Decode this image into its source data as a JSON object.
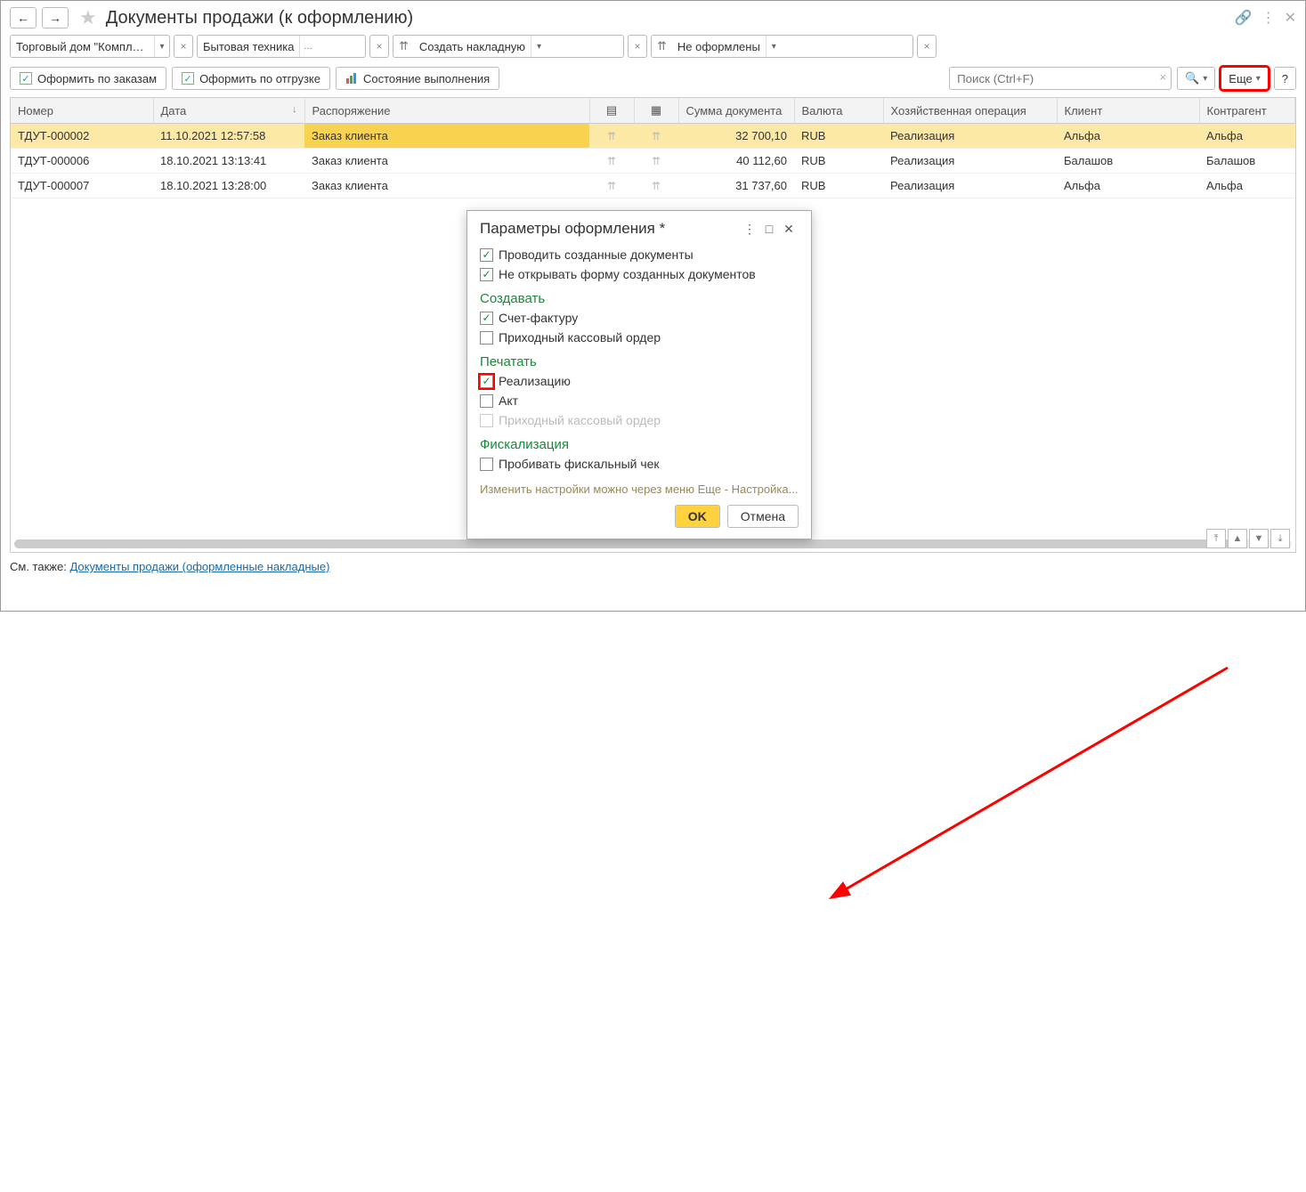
{
  "header": {
    "title": "Документы продажи (к оформлению)"
  },
  "filters": {
    "org": "Торговый дом \"Комплексн",
    "warehouse": "Бытовая техника",
    "create": "Создать накладную",
    "status": "Не оформлены"
  },
  "toolbar": {
    "by_orders": "Оформить по заказам",
    "by_shipment": "Оформить по отгрузке",
    "status_btn": "Состояние выполнения",
    "search_placeholder": "Поиск (Ctrl+F)",
    "more": "Еще"
  },
  "columns": {
    "number": "Номер",
    "date": "Дата",
    "order": "Распоряжение",
    "sum": "Сумма документа",
    "currency": "Валюта",
    "operation": "Хозяйственная операция",
    "client": "Клиент",
    "counterparty": "Контрагент"
  },
  "rows": [
    {
      "number": "ТДУТ-000002",
      "date": "11.10.2021 12:57:58",
      "order": "Заказ клиента",
      "sum": "32 700,10",
      "currency": "RUB",
      "operation": "Реализация",
      "client": "Альфа",
      "counterparty": "Альфа"
    },
    {
      "number": "ТДУТ-000006",
      "date": "18.10.2021 13:13:41",
      "order": "Заказ клиента",
      "sum": "40 112,60",
      "currency": "RUB",
      "operation": "Реализация",
      "client": "Балашов",
      "counterparty": "Балашов"
    },
    {
      "number": "ТДУТ-000007",
      "date": "18.10.2021 13:28:00",
      "order": "Заказ клиента",
      "sum": "31 737,60",
      "currency": "RUB",
      "operation": "Реализация",
      "client": "Альфа",
      "counterparty": "Альфа"
    }
  ],
  "dialog": {
    "title": "Параметры оформления *",
    "cb_post": "Проводить созданные документы",
    "cb_noopen": "Не открывать форму созданных документов",
    "sect_create": "Создавать",
    "cb_invoice": "Счет-фактуру",
    "cb_cash_in": "Приходный кассовый ордер",
    "sect_print": "Печатать",
    "cb_realize": "Реализацию",
    "cb_act": "Акт",
    "cb_cash_in2": "Приходный кассовый ордер",
    "sect_fiscal": "Фискализация",
    "cb_fiscal": "Пробивать фискальный чек",
    "hint": "Изменить настройки можно через меню Еще - Настройка...",
    "ok": "OK",
    "cancel": "Отмена"
  },
  "footer": {
    "prefix": "См. также: ",
    "link": "Документы продажи (оформленные накладные)"
  }
}
